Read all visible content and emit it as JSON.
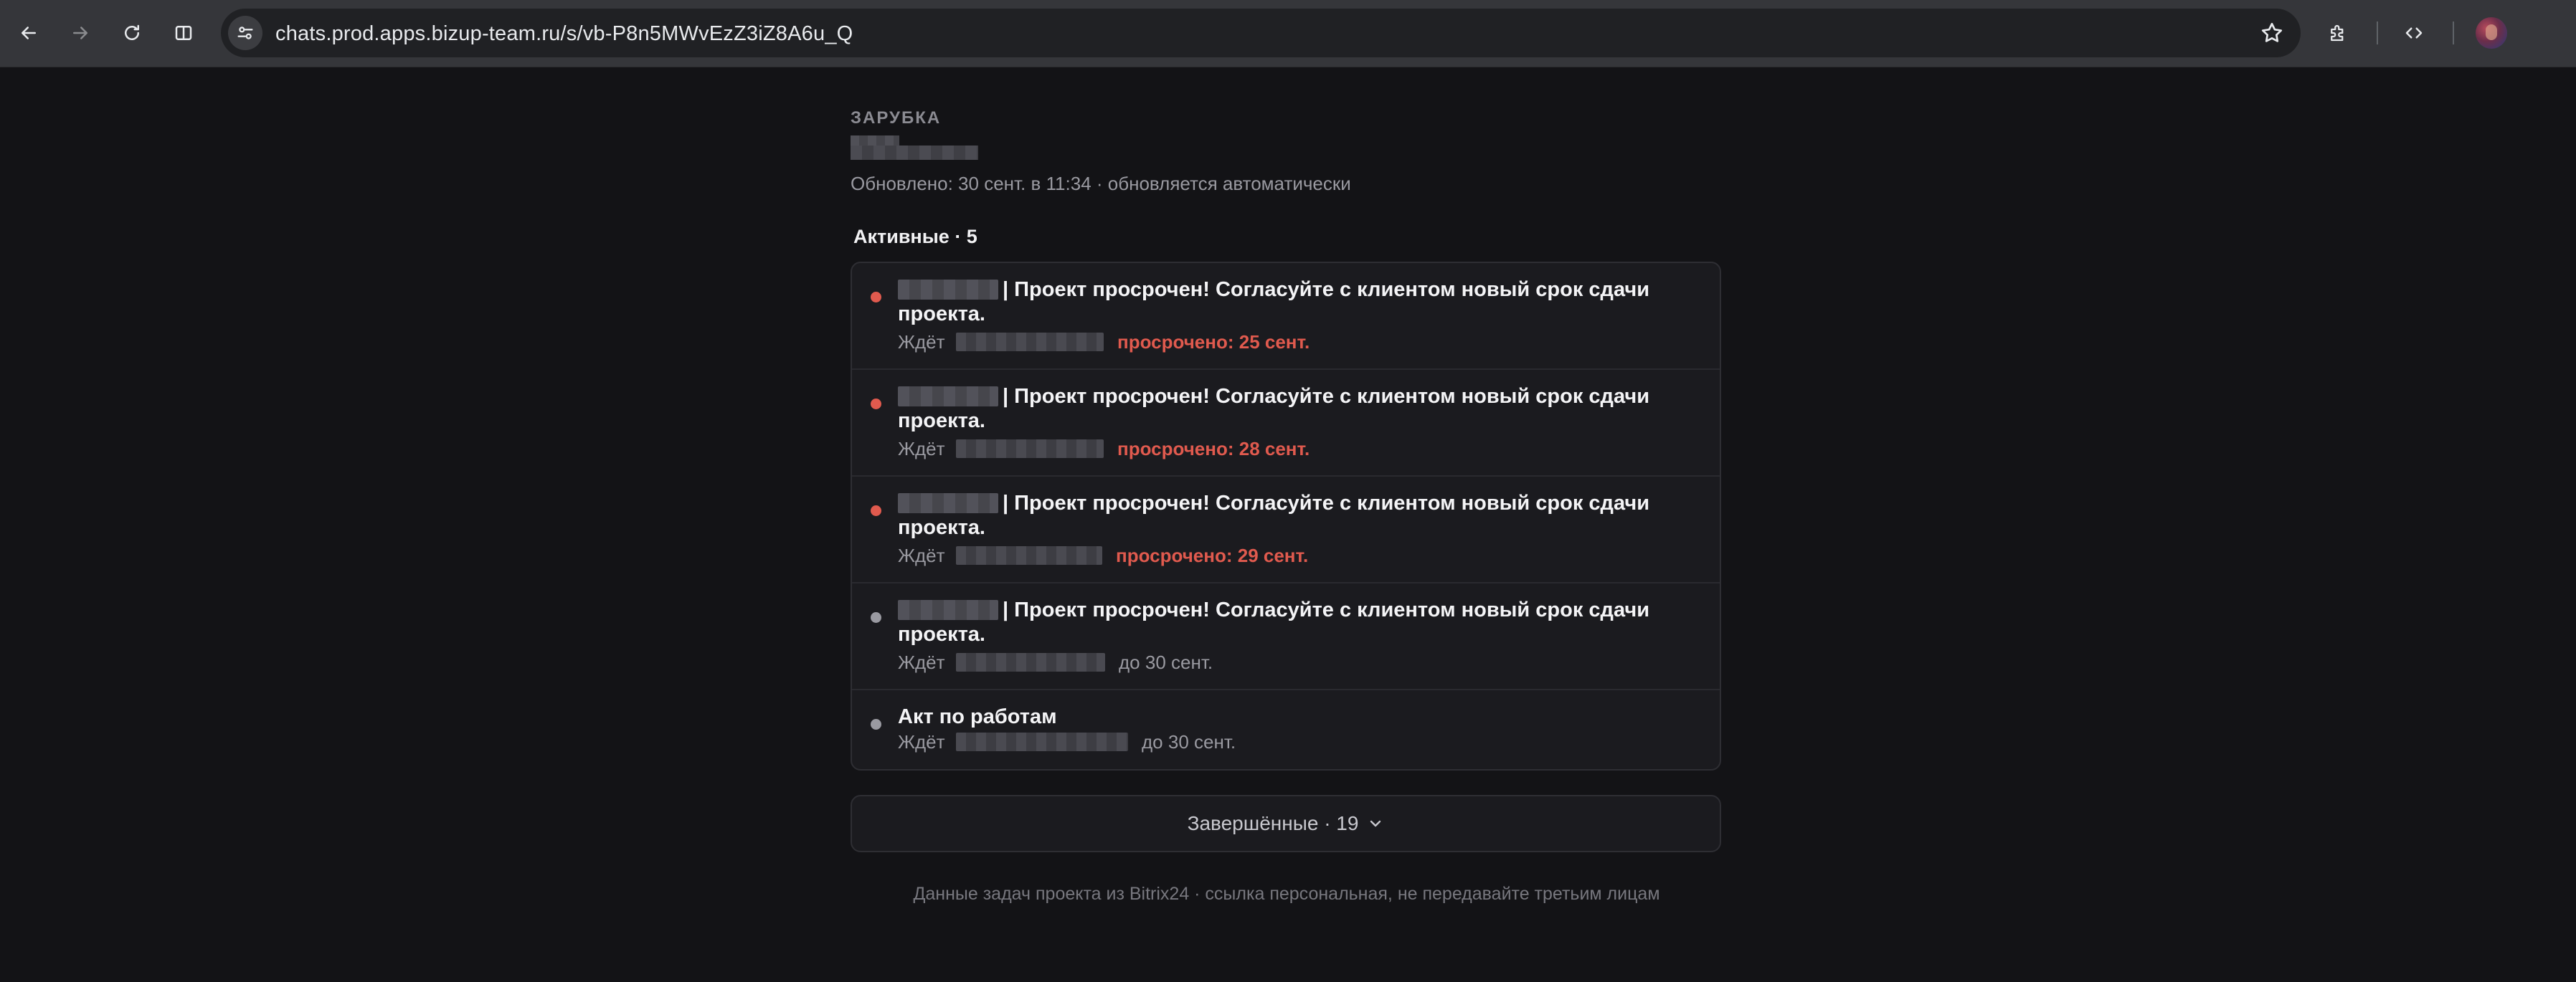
{
  "browser": {
    "url": "chats.prod.apps.bizup-team.ru/s/vb-P8n5MWvEzZ3iZ8A6u_Q"
  },
  "header": {
    "project_label": "ЗАРУБКА",
    "updated_text": "Обновлено: 30 сент. в 11:34 · обновляется автоматически"
  },
  "active": {
    "title": "Активные · 5",
    "tasks": [
      {
        "title": "| Проект просрочен! Согласуйте с клиентом новый срок сдачи проекта.",
        "waiting_label": "Ждёт",
        "due": "просрочено: 25 сент.",
        "status": "overdue",
        "dot_color": "#e05a4e"
      },
      {
        "title": "| Проект просрочен! Согласуйте с клиентом новый срок сдачи проекта.",
        "waiting_label": "Ждёт",
        "due": "просрочено: 28 сент.",
        "status": "overdue",
        "dot_color": "#e05a4e"
      },
      {
        "title": "| Проект просрочен! Согласуйте с клиентом новый срок сдачи проекта.",
        "waiting_label": "Ждёт",
        "due": "просрочено: 29 сент.",
        "status": "overdue",
        "dot_color": "#e05a4e"
      },
      {
        "title": "| Проект просрочен! Согласуйте с клиентом новый срок сдачи проекта.",
        "waiting_label": "Ждёт",
        "due": "до 30 сент.",
        "status": "normal",
        "dot_color": "#9a9aa1"
      },
      {
        "title": "Акт по работам",
        "waiting_label": "Ждёт",
        "due": "до 30 сент.",
        "status": "normal",
        "dot_color": "#9a9aa1"
      }
    ]
  },
  "completed": {
    "label": "Завершённые · 19"
  },
  "footer": {
    "text": "Данные задач проекта из Bitrix24 · ссылка персональная, не передавайте третьим лицам"
  },
  "colors": {
    "background": "#131316",
    "card": "#1b1b1f",
    "overdue": "#e05a4e",
    "muted": "#9a9aa1"
  }
}
